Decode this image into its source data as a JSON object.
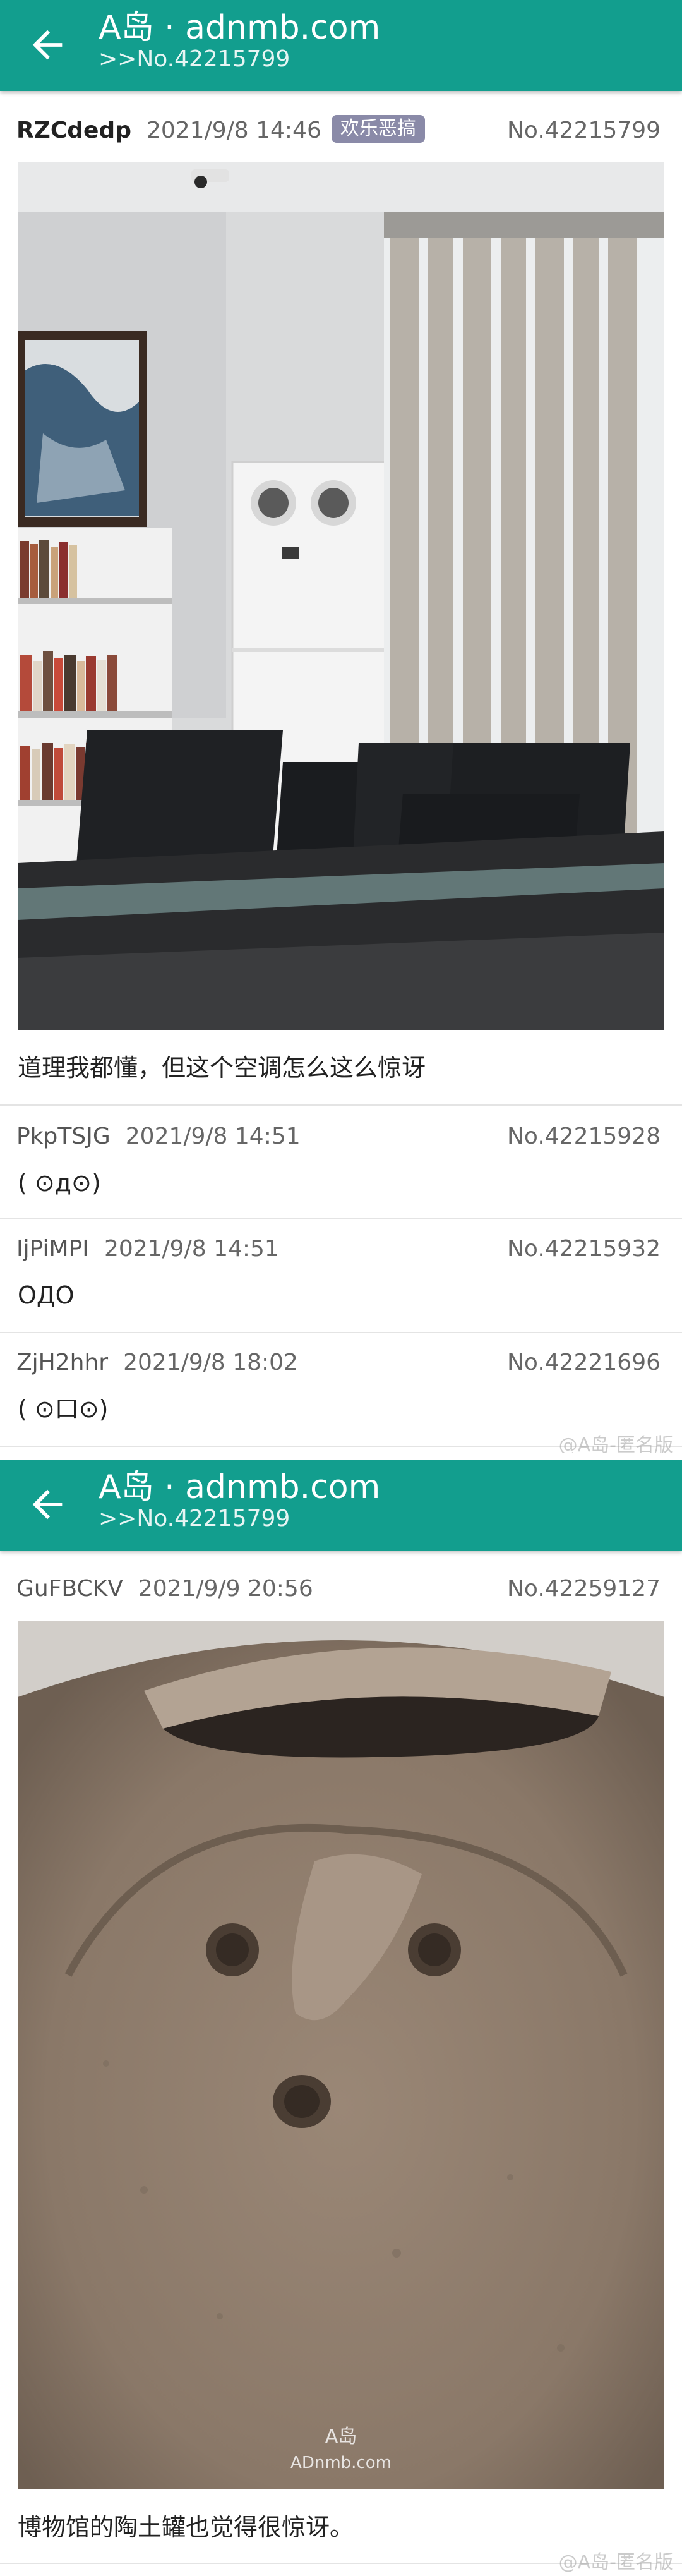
{
  "panels": [
    {
      "appbar": {
        "title": "A岛 · adnmb.com",
        "subtitle": ">>No.42215799"
      },
      "op": {
        "user": "RZCdedp",
        "time": "2021/9/8 14:46",
        "tag": "欢乐恶搞",
        "no": "No.42215799",
        "text": "道理我都懂，但这个空调怎么这么惊讶"
      },
      "replies": [
        {
          "user": "PkpTSJG",
          "time": "2021/9/8 14:51",
          "no": "No.42215928",
          "text": "( ⊙д⊙)"
        },
        {
          "user": "IjPiMPI",
          "time": "2021/9/8 14:51",
          "no": "No.42215932",
          "text": "ОДО"
        },
        {
          "user": "ZjH2hhr",
          "time": "2021/9/8 18:02",
          "no": "No.42221696",
          "text": "( ⊙口⊙)"
        }
      ],
      "watermark": "@A岛-匿名版"
    },
    {
      "appbar": {
        "title": "A岛 · adnmb.com",
        "subtitle": ">>No.42215799"
      },
      "reply": {
        "user": "GuFBCKV",
        "time": "2021/9/9 20:56",
        "no": "No.42259127",
        "text": "博物馆的陶土罐也觉得很惊讶。"
      },
      "image_watermark": {
        "line1": "A岛",
        "line2": "ADnmb.com"
      },
      "watermark": "@A岛-匿名版"
    }
  ],
  "colors": {
    "appbar": "#129e8e",
    "tag": "#8a8aa8"
  }
}
